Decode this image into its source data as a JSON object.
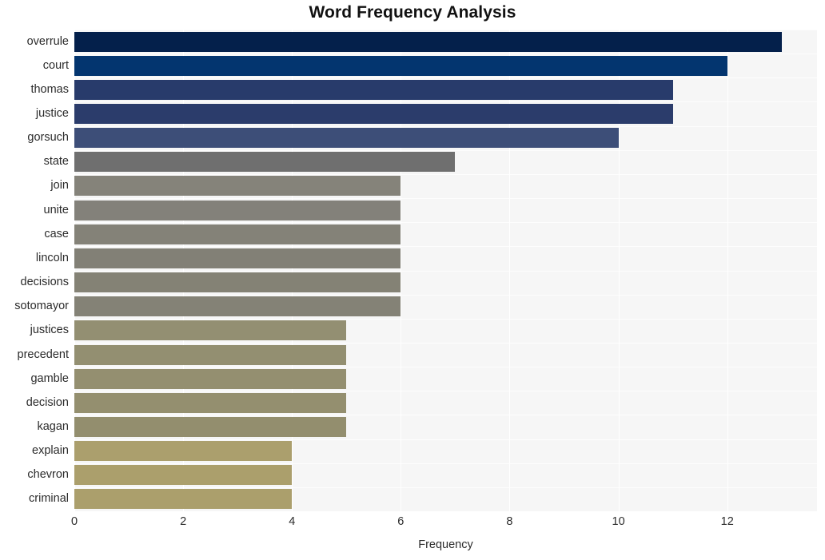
{
  "chart_data": {
    "type": "bar",
    "orientation": "horizontal",
    "title": "Word Frequency Analysis",
    "xlabel": "Frequency",
    "ylabel": "",
    "xlim": [
      0,
      13.65
    ],
    "xticks": [
      0,
      2,
      4,
      6,
      8,
      10,
      12
    ],
    "xtick_labels": [
      "0",
      "2",
      "4",
      "6",
      "8",
      "10",
      "12"
    ],
    "grid": true,
    "legend": null,
    "categories": [
      "overrule",
      "court",
      "thomas",
      "justice",
      "gorsuch",
      "state",
      "join",
      "unite",
      "case",
      "lincoln",
      "decisions",
      "sotomayor",
      "justices",
      "precedent",
      "gamble",
      "decision",
      "kagan",
      "explain",
      "chevron",
      "criminal"
    ],
    "values": [
      13,
      12,
      11,
      11,
      10,
      7,
      6,
      6,
      6,
      6,
      6,
      6,
      5,
      5,
      5,
      5,
      5,
      4,
      4,
      4
    ],
    "bar_colors": [
      "#04204b",
      "#03356f",
      "#283b6b",
      "#2b3c6b",
      "#3d4e78",
      "#6f6f6f",
      "#85837a",
      "#83817a",
      "#848278",
      "#828076",
      "#848275",
      "#848276",
      "#938f72",
      "#938f71",
      "#948f70",
      "#948f6f",
      "#938e6e",
      "#ab9f6d",
      "#ab9f6c",
      "#ab9f6c"
    ],
    "plot_background": "#f6f6f6",
    "gridline_color": "#ffffff",
    "figure_background": "#ffffff",
    "title_color": "#111111",
    "tick_color": "#2b2b2b"
  }
}
